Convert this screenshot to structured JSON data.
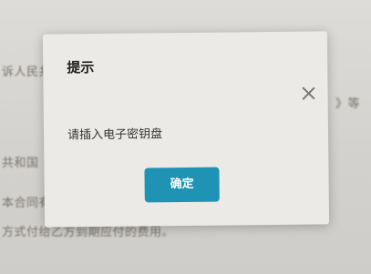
{
  "dialog": {
    "title": "提示",
    "message": "请插入电子密钥盘",
    "confirm_label": "确定",
    "close_icon": "close-icon"
  },
  "background_document": {
    "lines": [
      "诉人民共",
      "》等",
      "共和国",
      "本合同有效期内乙方有权以出、同",
      "方式付给乙方到期应付的费用。",
      "方式付给乙方到期应付的费用。"
    ]
  },
  "colors": {
    "accent": "#1e93b4",
    "dialog_bg": "#ebeae6",
    "page_bg": "#d9d7d3"
  }
}
